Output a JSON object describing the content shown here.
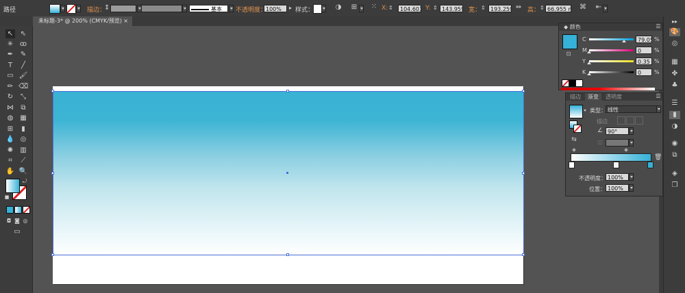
{
  "control_bar": {
    "path_label": "路径",
    "stroke_label": "描边：",
    "stroke_profile": "基本",
    "opacity_label": "不透明度：",
    "opacity_value": "100%",
    "style_label": "样式：",
    "x_label": "X:",
    "x_value": "104.601",
    "y_label": "Y:",
    "y_value": "143.959",
    "w_label": "宽：",
    "w_value": "193.259",
    "h_label": "高：",
    "h_value": "66.955 m"
  },
  "document_tab": {
    "title": "未标题-3* @ 200% (CMYK/预览)",
    "close_glyph": "×"
  },
  "color_panel": {
    "tab": "颜色",
    "channels": [
      {
        "name": "C",
        "value": "79.05",
        "unit": "%",
        "level": 0.79
      },
      {
        "name": "M",
        "value": "0",
        "unit": "%",
        "level": 0.0
      },
      {
        "name": "Y",
        "value": "0.35",
        "unit": "%",
        "level": 0.0035
      },
      {
        "name": "K",
        "value": "0",
        "unit": "%",
        "level": 0.0
      }
    ],
    "swatch_color": "#36b1d7"
  },
  "gradient_panel": {
    "tabs": [
      "描边",
      "渐变",
      "透明度"
    ],
    "type_label": "类型：",
    "type_value": "线性",
    "stroke_label": "描边",
    "angle_value": "90°",
    "opacity_label": "不透明度：",
    "opacity_value": "100%",
    "position_label": "位置：",
    "position_value": "100%",
    "start_color": "#ffffff",
    "end_color": "#36b1d7"
  },
  "colors": {
    "accent_blue": "#36b1d7",
    "selection_blue": "#4a6fd8"
  }
}
